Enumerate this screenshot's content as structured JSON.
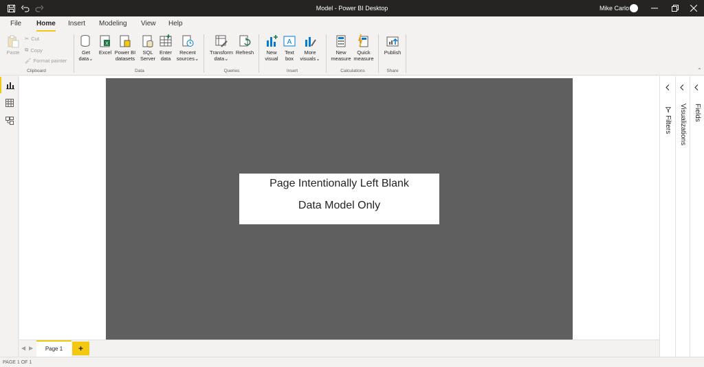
{
  "app": {
    "title": "Model - Power BI Desktop",
    "user": "Mike Carlo"
  },
  "menu": {
    "tabs": [
      {
        "label": "File"
      },
      {
        "label": "Home"
      },
      {
        "label": "Insert"
      },
      {
        "label": "Modeling"
      },
      {
        "label": "View"
      },
      {
        "label": "Help"
      }
    ]
  },
  "ribbon": {
    "clipboard": {
      "paste": "Paste",
      "cut": "Cut",
      "copy": "Copy",
      "format_painter": "Format painter",
      "group": "Clipboard"
    },
    "data": {
      "get_data_1": "Get",
      "get_data_2": "data",
      "excel": "Excel",
      "pbi_1": "Power BI",
      "pbi_2": "datasets",
      "sql_1": "SQL",
      "sql_2": "Server",
      "enter_1": "Enter",
      "enter_2": "data",
      "recent_1": "Recent",
      "recent_2": "sources",
      "group": "Data"
    },
    "queries": {
      "transform_1": "Transform",
      "transform_2": "data",
      "refresh": "Refresh",
      "group": "Queries"
    },
    "insert": {
      "newvisual_1": "New",
      "newvisual_2": "visual",
      "textbox_1": "Text",
      "textbox_2": "box",
      "more_1": "More",
      "more_2": "visuals",
      "group": "Insert"
    },
    "calculations": {
      "newmeasure_1": "New",
      "newmeasure_2": "measure",
      "quick_1": "Quick",
      "quick_2": "measure",
      "group": "Calculations"
    },
    "share": {
      "publish": "Publish",
      "group": "Share"
    }
  },
  "canvas": {
    "line1": "Page Intentionally Left Blank",
    "line2": "Data Model Only"
  },
  "panes": {
    "filters": "Filters",
    "visualizations": "Visualizations",
    "fields": "Fields"
  },
  "pages": {
    "tabs": [
      {
        "label": "Page 1"
      }
    ],
    "add": "+"
  },
  "status": {
    "text": "PAGE 1 OF 1"
  },
  "colors": {
    "accent": "#f2c811",
    "titlebar": "#252423",
    "page_background": "#605f5f"
  }
}
